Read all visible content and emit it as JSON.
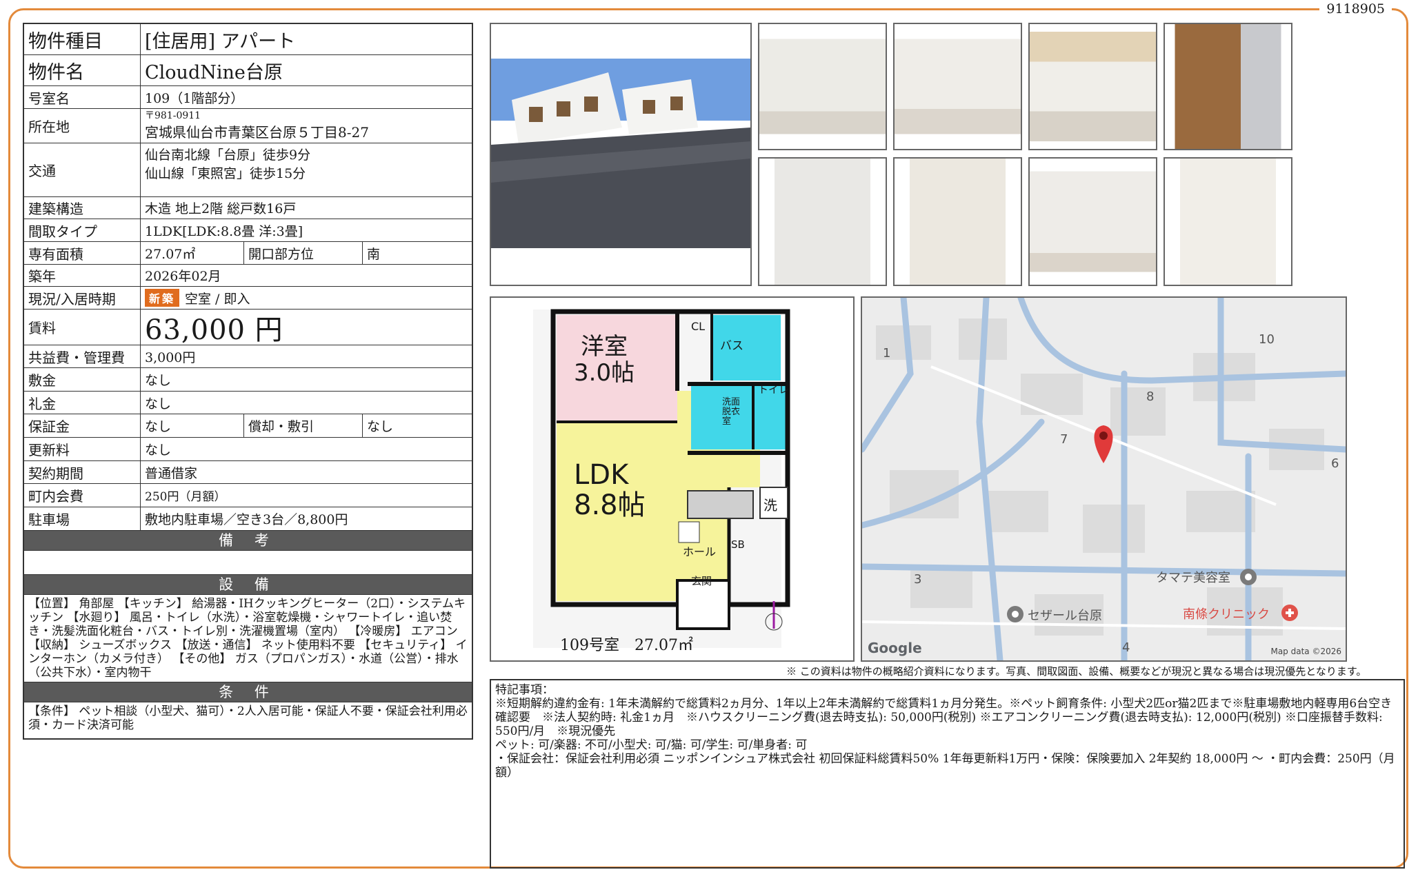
{
  "doc_id": "9118905",
  "spec": {
    "type_label": "物件種目",
    "type_value": "[住居用] アパート",
    "name_label": "物件名",
    "name_value": "CloudNine台原",
    "room_label": "号室名",
    "room_value": "109（1階部分）",
    "address_label": "所在地",
    "postal": "〒981-0911",
    "address": "宮城県仙台市青葉区台原５丁目8-27",
    "transport_label": "交通",
    "transport_1": "仙台南北線「台原」徒歩9分",
    "transport_2": "仙山線「東照宮」徒歩15分",
    "structure_label": "建築構造",
    "structure_value": "木造 地上2階 総戸数16戸",
    "layout_label": "間取タイプ",
    "layout_value": "1LDK[LDK:8.8畳 洋:3畳]",
    "area_label": "専有面積",
    "area_value": "27.07㎡",
    "opening_label": "開口部方位",
    "opening_value": "南",
    "built_label": "築年",
    "built_value": "2026年02月",
    "status_label": "現況/入居時期",
    "status_badge": "新築",
    "status_value": "空室 / 即入",
    "rent_label": "賃料",
    "rent_value": "63,000 円",
    "fee_label": "共益費・管理費",
    "fee_value": "3,000円",
    "deposit_label": "敷金",
    "deposit_value": "なし",
    "keymoney_label": "礼金",
    "keymoney_value": "なし",
    "guarantee_label": "保証金",
    "guarantee_value": "なし",
    "amort_label": "償却・敷引",
    "amort_value": "なし",
    "renewal_label": "更新料",
    "renewal_value": "なし",
    "contract_label": "契約期間",
    "contract_value": "普通借家",
    "town_label": "町内会費",
    "town_value": "250円（月額）",
    "parking_label": "駐車場",
    "parking_value": "敷地内駐車場／空き3台／8,800円"
  },
  "sections": {
    "notes_header": "備 考",
    "equipment_header": "設 備",
    "equipment_text": "【位置】 角部屋 【キッチン】 給湯器・IHクッキングヒーター（2口）・システムキッチン 【水廻り】 風呂・トイレ（水洗）・浴室乾燥機・シャワートイレ・追い焚き・洗髪洗面化粧台・バス・トイレ別・洗濯機置場（室内） 【冷暖房】 エアコン 【収納】 シューズボックス 【放送・通信】 ネット使用料不要 【セキュリティ】 インターホン（カメラ付き） 【その他】 ガス（プロパンガス）・水道（公営）・排水（公共下水）・室内物干",
    "conditions_header": "条 件",
    "conditions_text": "【条件】 ペット相談（小型犬、猫可）・2人入居可能・保証人不要・保証会社利用必須・カード決済可能"
  },
  "floorplan": {
    "room_western": "洋室",
    "room_western_size": "3.0帖",
    "cl": "CL",
    "bath": "バス",
    "toilet": "トイレ",
    "washroom": "洗面脱衣室",
    "laundry": "洗",
    "ldk": "LDK",
    "ldk_size": "8.8帖",
    "hall": "ホール",
    "sb": "SB",
    "entrance": "玄関",
    "caption": "109号室　27.07㎡"
  },
  "map": {
    "labels": [
      "1",
      "10",
      "8",
      "7",
      "6",
      "3",
      "4"
    ],
    "poi_1": "タマテ美容室",
    "poi_2": "セザール台原",
    "poi_3": "南條クリニック",
    "google": "Google",
    "map_data": "Map data ©2026"
  },
  "disclaimer": "※ この資料は物件の概略紹介資料になります。写真、間取図面、設備、概要などが現況と異なる場合は現況優先となります。",
  "remarks": {
    "title": "特記事項：",
    "line1": "※短期解約違約金有: 1年未満解約で総賃料2ヵ月分、1年以上2年未満解約で総賃料1ヵ月分発生。※ペット飼育条件: 小型犬2匹or猫2匹まで※駐車場敷地内軽専用6台空き確認要　※法人契約時: 礼金1ヵ月　※ハウスクリーニング費(退去時支払): 50,000円(税別) ※エアコンクリーニング費(退去時支払): 12,000円(税別) ※口座振替手数料: 550円/月　※現況優先",
    "line2": "ペット: 可/楽器: 不可/小型犬: 可/猫: 可/学生: 可/単身者: 可",
    "line3": "・保証会社：保証会社利用必須 ニッポンインシュア株式会社 初回保証料総賃料50% 1年毎更新料1万円・保険：保険要加入 2年契約 18,000円 〜 ・町内会費：250円（月額）"
  },
  "colors": {
    "frame": "#e38a3b",
    "badge": "#e06c1e",
    "header_bg": "#5a5a5a",
    "western_room": "#f7d7dd",
    "ldk_room": "#f6f39b",
    "water_room": "#41d7e9"
  }
}
